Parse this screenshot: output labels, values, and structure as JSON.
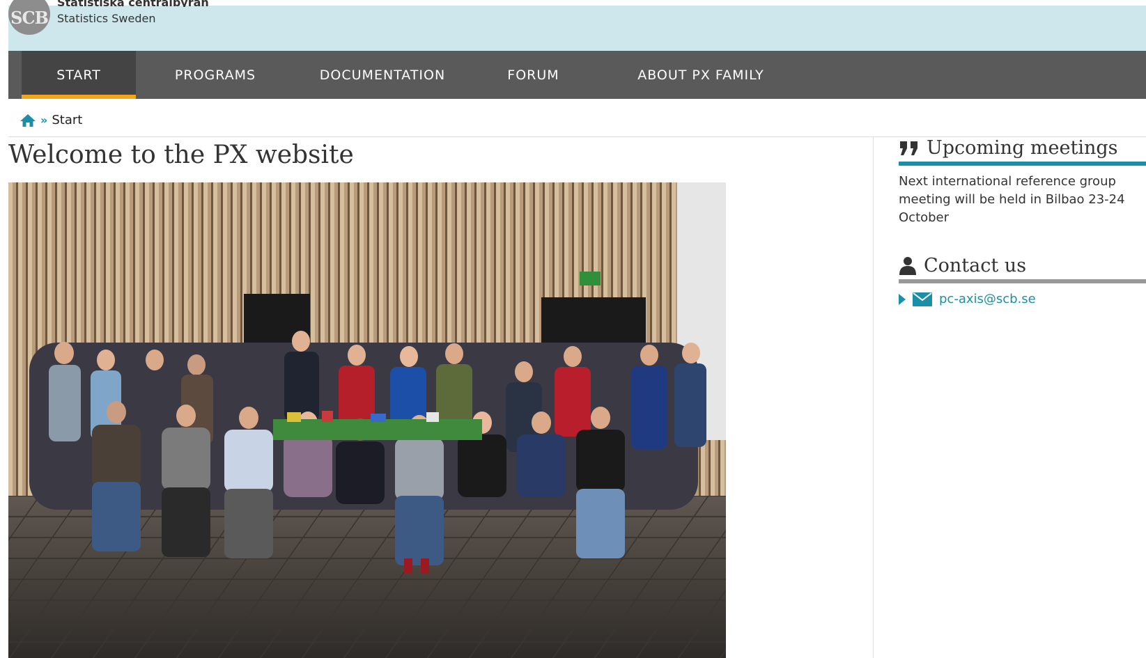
{
  "header": {
    "logo_text": "SCB",
    "org_name_sv": "Statistiska centralbyrån",
    "org_name_en": "Statistics Sweden"
  },
  "nav": {
    "items": [
      {
        "label": "START",
        "active": true
      },
      {
        "label": "PROGRAMS"
      },
      {
        "label": "DOCUMENTATION"
      },
      {
        "label": "FORUM"
      },
      {
        "label": "ABOUT PX FAMILY"
      }
    ]
  },
  "breadcrumb": {
    "separator": "»",
    "current": "Start"
  },
  "main": {
    "title": "Welcome to the PX website"
  },
  "sidebar": {
    "meetings": {
      "heading": "Upcoming meetings",
      "text": "Next international reference group meeting will be held in Bilbao 23-24 October"
    },
    "contact": {
      "heading": "Contact us",
      "email": "pc-axis@scb.se"
    }
  },
  "colors": {
    "accent": "#1b8fa8",
    "nav_bg": "#5a5a5a",
    "nav_active_underline": "#f4a51c",
    "banner_bg": "#cde7ec"
  }
}
